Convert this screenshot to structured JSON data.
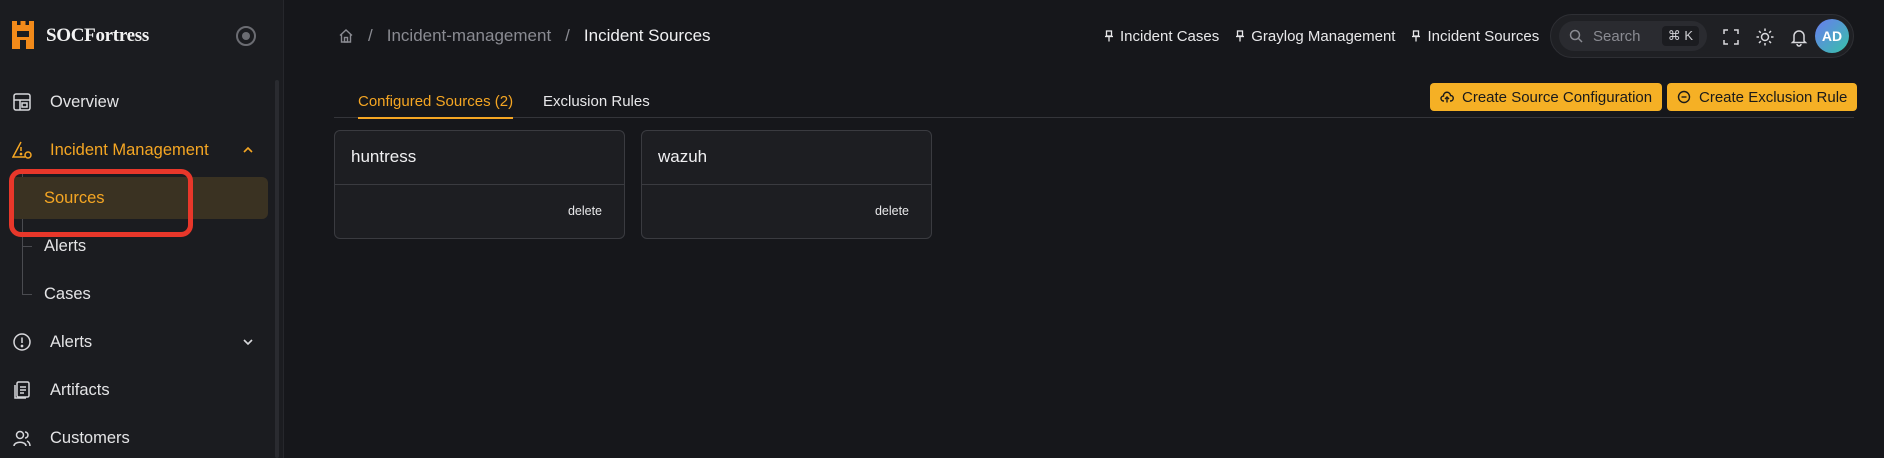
{
  "app": {
    "brand": "SOCFortress"
  },
  "sidebar": {
    "items": [
      {
        "label": "Overview",
        "icon": "overview-icon"
      },
      {
        "label": "Incident Management",
        "icon": "alert-settings-icon",
        "expanded": true,
        "children": [
          {
            "label": "Sources",
            "selected": true
          },
          {
            "label": "Alerts"
          },
          {
            "label": "Cases"
          }
        ]
      },
      {
        "label": "Alerts",
        "icon": "alert-circle-icon",
        "expanded": false
      },
      {
        "label": "Artifacts",
        "icon": "artifacts-icon"
      },
      {
        "label": "Customers",
        "icon": "users-icon"
      }
    ]
  },
  "breadcrumb": {
    "level1": "Incident-management",
    "sep": "/",
    "current": "Incident Sources"
  },
  "pins": [
    "Incident Cases",
    "Graylog Management",
    "Incident Sources"
  ],
  "search": {
    "placeholder": "Search",
    "shortcut": "⌘ K"
  },
  "user": {
    "initials": "AD"
  },
  "tabs": [
    {
      "label": "Configured Sources (2)",
      "active": true
    },
    {
      "label": "Exclusion Rules",
      "active": false
    }
  ],
  "actions": {
    "create_source": "Create Source Configuration",
    "create_exclusion": "Create Exclusion Rule"
  },
  "sources": [
    {
      "name": "huntress",
      "delete_label": "delete"
    },
    {
      "name": "wazuh",
      "delete_label": "delete"
    }
  ],
  "colors": {
    "accent": "#f5a623",
    "button": "#f5b025",
    "highlight": "#e8372a",
    "background": "#16171b"
  }
}
